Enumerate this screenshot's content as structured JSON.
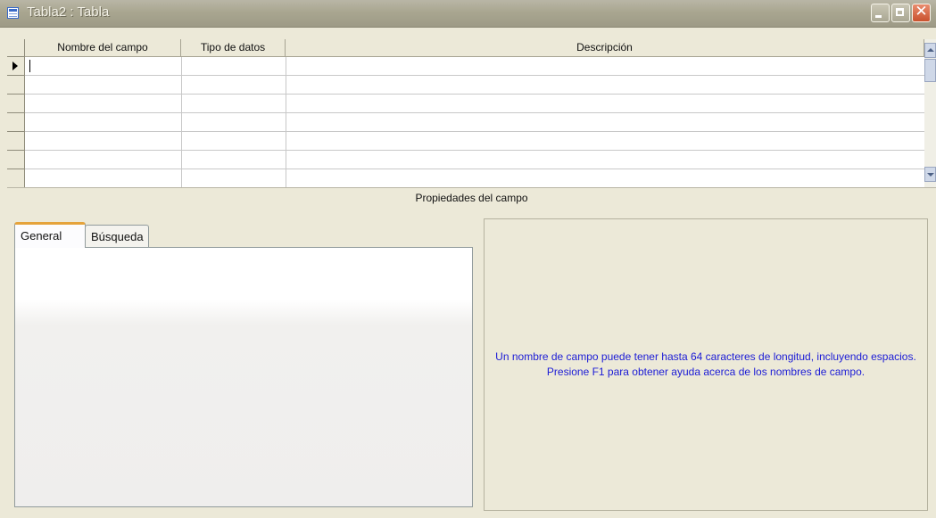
{
  "window": {
    "title": "Tabla2 : Tabla"
  },
  "grid": {
    "columns": [
      "Nombre del campo",
      "Tipo de datos",
      "Descripción"
    ],
    "row_count": 7
  },
  "properties": {
    "section_title": "Propiedades del campo",
    "tabs": [
      {
        "label": "General",
        "active": true
      },
      {
        "label": "Búsqueda",
        "active": false
      }
    ],
    "help_text": "Un nombre de campo puede tener hasta 64 caracteres de longitud, incluyendo espacios. Presione F1 para obtener ayuda acerca de los nombres de campo."
  },
  "colors": {
    "help_text": "#1b1bd6",
    "active_tab_accent": "#e5a33b",
    "window_bg": "#ece9d8"
  }
}
